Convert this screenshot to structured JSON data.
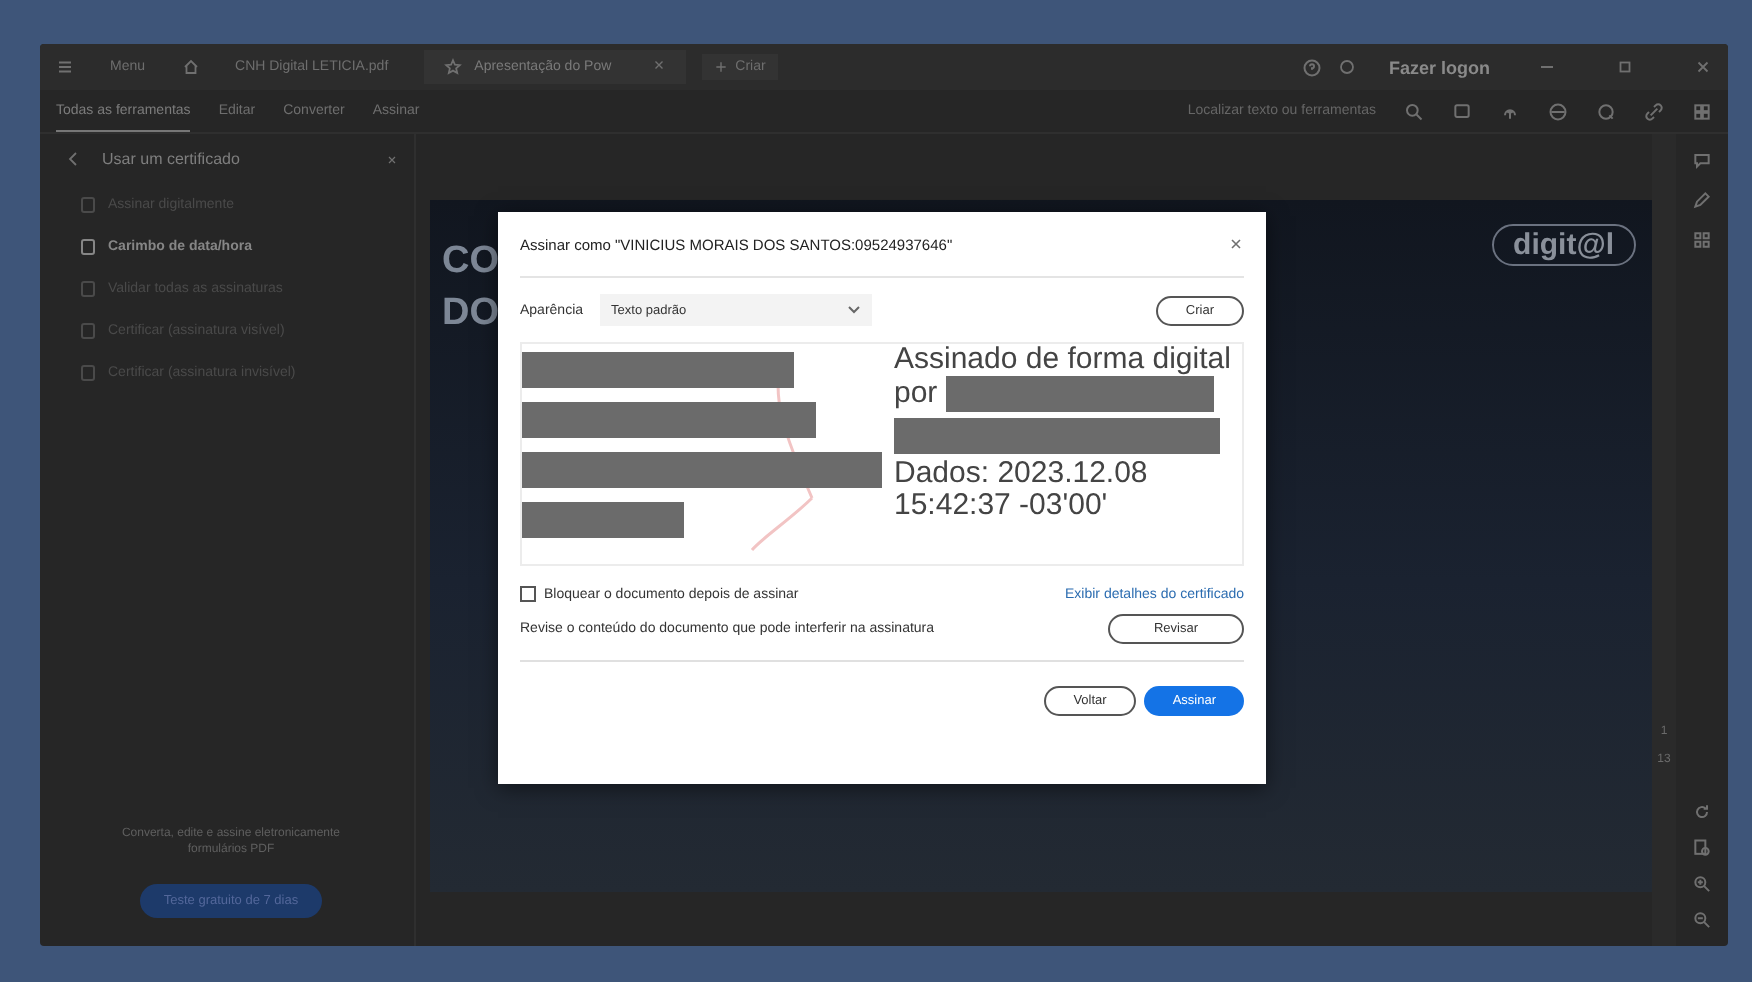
{
  "titlebar": {
    "menu": "Menu",
    "tabs": [
      {
        "label": "CNH Digital LETICIA.pdf",
        "selected": false
      },
      {
        "label": "Apresentação do Pow",
        "selected": true
      }
    ],
    "create": "Criar",
    "login": "Fazer logon"
  },
  "toolbar": {
    "items": [
      {
        "label": "Todas as ferramentas",
        "selected": true
      },
      {
        "label": "Editar",
        "selected": false
      },
      {
        "label": "Converter",
        "selected": false
      },
      {
        "label": "Assinar",
        "selected": false
      }
    ],
    "search": "Localizar texto ou ferramentas"
  },
  "panel": {
    "title": "Usar um certificado",
    "items": [
      {
        "label": "Assinar digitalmente",
        "selected": false
      },
      {
        "label": "Carimbo de data/hora",
        "selected": true
      },
      {
        "label": "Validar todas as assinaturas",
        "selected": false
      },
      {
        "label": "Certificar (assinatura visível)",
        "selected": false
      },
      {
        "label": "Certificar (assinatura invisível)",
        "selected": false
      }
    ],
    "promo": "Converta, edite e assine eletronicamente formulários PDF",
    "trial_button": "Teste gratuito de 7 dias"
  },
  "slide": {
    "title_lines": [
      "CO",
      "DO"
    ],
    "logo": "digit@l"
  },
  "page_nav": {
    "current": "1",
    "total": "13"
  },
  "dialog": {
    "title": "Assinar como \"VINICIUS MORAIS DOS SANTOS:09524937646\"",
    "appearance_label": "Aparência",
    "appearance_value": "Texto padrão",
    "create_button": "Criar",
    "preview": {
      "signed_line": "Assinado de forma digital",
      "by": "por",
      "date_line": "Dados: 2023.12.08",
      "time_line": "15:42:37 -03'00'"
    },
    "lock": {
      "label": "Bloquear o documento depois de assinar",
      "checked": false
    },
    "details_link": "Exibir detalhes do certificado",
    "review_text": "Revise o conteúdo do documento que pode interferir na assinatura",
    "review_button": "Revisar",
    "back_button": "Voltar",
    "sign_button": "Assinar"
  }
}
